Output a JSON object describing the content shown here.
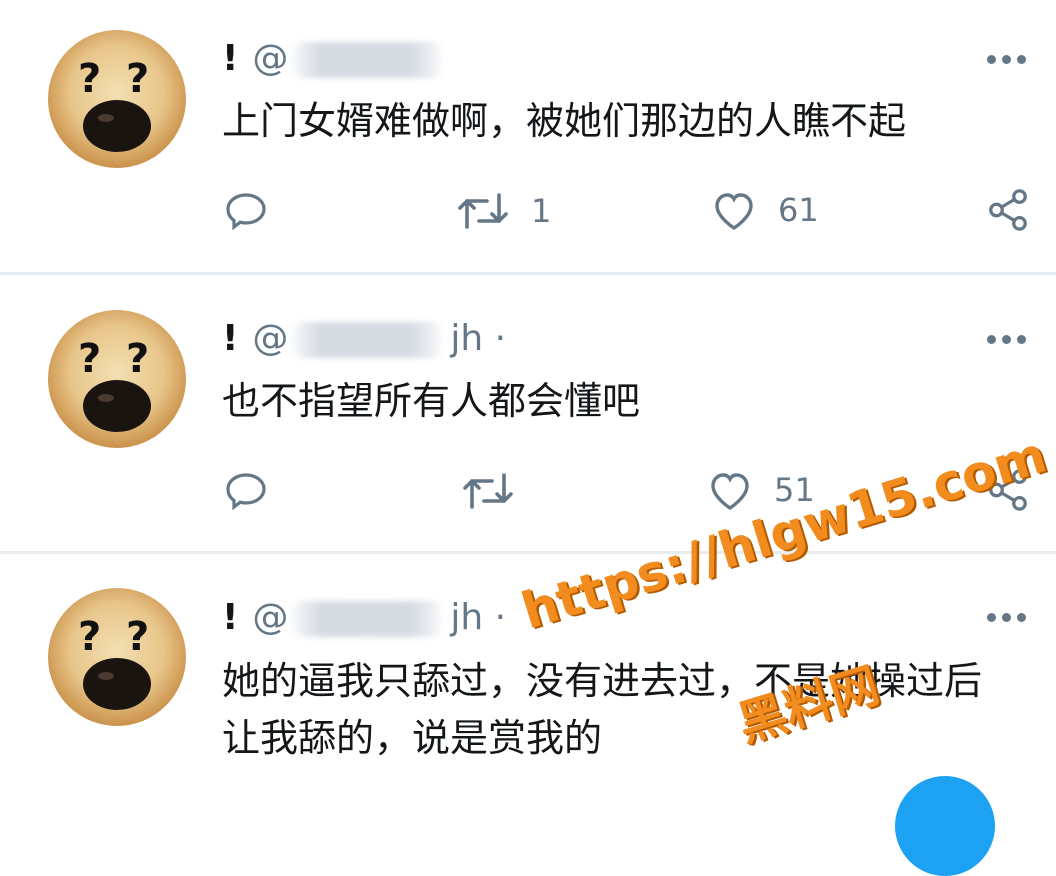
{
  "tweets": [
    {
      "bang": "!",
      "handle_prefix": "@",
      "handle_tail": "",
      "text": "上门女婿难做啊，被她们那边的人瞧不起",
      "retweets": "1",
      "likes": "61"
    },
    {
      "bang": "!",
      "handle_prefix": "@",
      "handle_tail": "jh ·",
      "text": "也不指望所有人都会懂吧",
      "retweets": "",
      "likes": "51"
    },
    {
      "bang": "!",
      "handle_prefix": "@",
      "handle_tail": "jh ·",
      "text_line1": "她的逼我只舔过，没有进去过，不是她操过后",
      "text_line2": "让我舔的，说是赏我的",
      "retweets": "",
      "likes": ""
    }
  ],
  "watermark": {
    "url": "https://hlgw15.com",
    "brand": "黑料网",
    "color": "#f28c1e"
  },
  "icons": {
    "reply": "reply-icon",
    "retweet": "retweet-icon",
    "like": "heart-icon",
    "share": "share-icon",
    "more": "more-icon"
  },
  "colors": {
    "text": "#14171a",
    "muted": "#657786",
    "divider": "#e6ecf0",
    "accent": "#1da1f2"
  }
}
